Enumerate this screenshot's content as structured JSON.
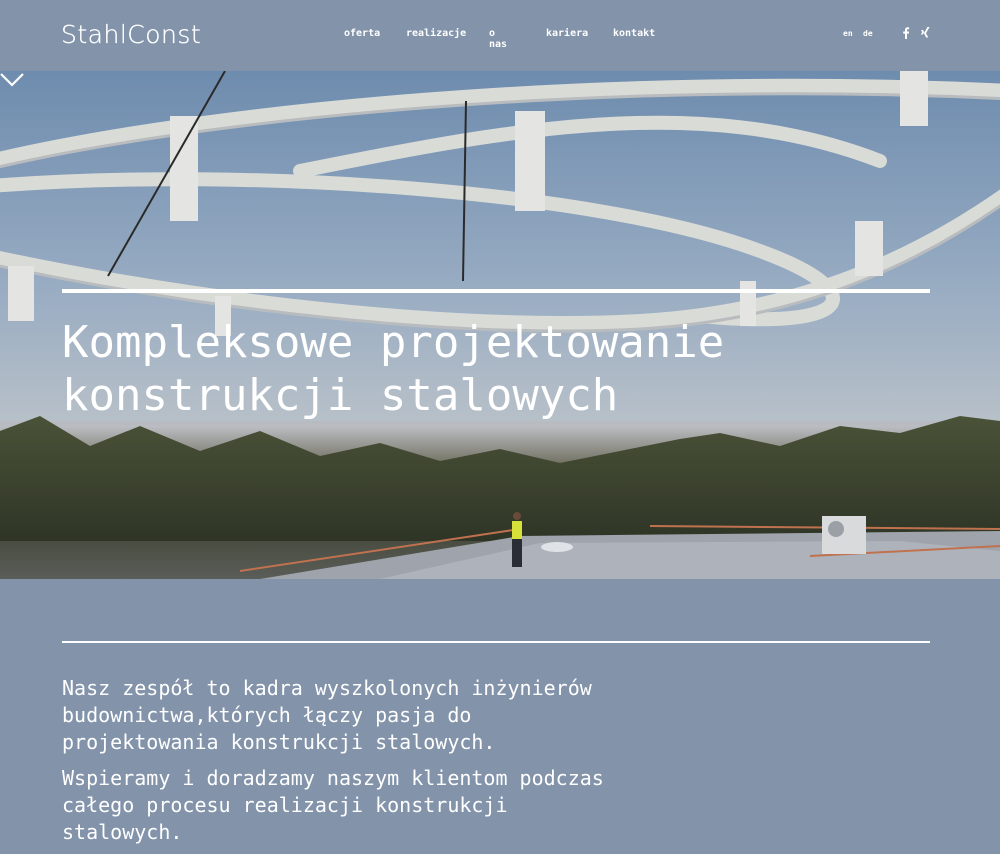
{
  "header": {
    "logo": "StahlConst",
    "nav": [
      {
        "label": "oferta"
      },
      {
        "label": "realizacje"
      },
      {
        "label": "o nas"
      },
      {
        "label": "kariera"
      },
      {
        "label": "kontakt"
      }
    ],
    "languages": [
      "en",
      "de"
    ],
    "social": [
      {
        "icon": "facebook-icon",
        "glyph": "f"
      },
      {
        "icon": "xing-icon",
        "glyph": "✕"
      }
    ]
  },
  "hero": {
    "title_line1": "Kompleksowe projektowanie",
    "title_line2": "konstrukcji stalowych",
    "scroll_icon": "chevron-down-icon"
  },
  "content": {
    "paragraph1": "Nasz zespół to kadra wyszkolonych inżynierów budownictwa,których łączy pasja do projektowania konstrukcji stalowych.",
    "paragraph2": "Wspieramy i doradzamy naszym klientom podczas całego procesu realizacji konstrukcji stalowych."
  },
  "colors": {
    "background": "#8293aa",
    "text": "#ffffff"
  }
}
